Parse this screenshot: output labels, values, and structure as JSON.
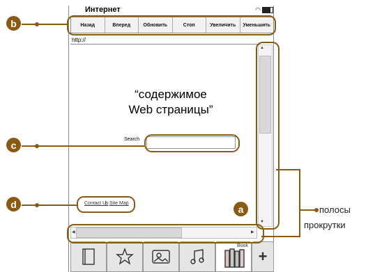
{
  "window": {
    "title": "Интернет"
  },
  "toolbar": {
    "buttons": [
      "Назад",
      "Вперед",
      "Обновить",
      "Стоп",
      "Увеличить",
      "Уменьшить"
    ]
  },
  "address": {
    "value": "http://"
  },
  "content": {
    "line1": "“содержимое",
    "line2": "Web страницы”",
    "search_label": "Search",
    "links": {
      "contact": "Contact Us",
      "separator": "|",
      "sitemap": "Site Map"
    }
  },
  "scrollbars": {
    "up": "▲",
    "down": "▼",
    "left": "◀",
    "right": "▶"
  },
  "tabs": [
    "book-icon",
    "star-icon",
    "photo-icon",
    "music-icon",
    "ebook-library-icon",
    "plus-icon"
  ],
  "tab_plus_label": "+",
  "tab_library_label": "Book",
  "callouts": {
    "a": "a",
    "b": "b",
    "c": "c",
    "d": "d"
  },
  "annotation": {
    "line1": "полосы",
    "line2": "прокрутки"
  },
  "colors": {
    "callout": "#8b5a12"
  }
}
